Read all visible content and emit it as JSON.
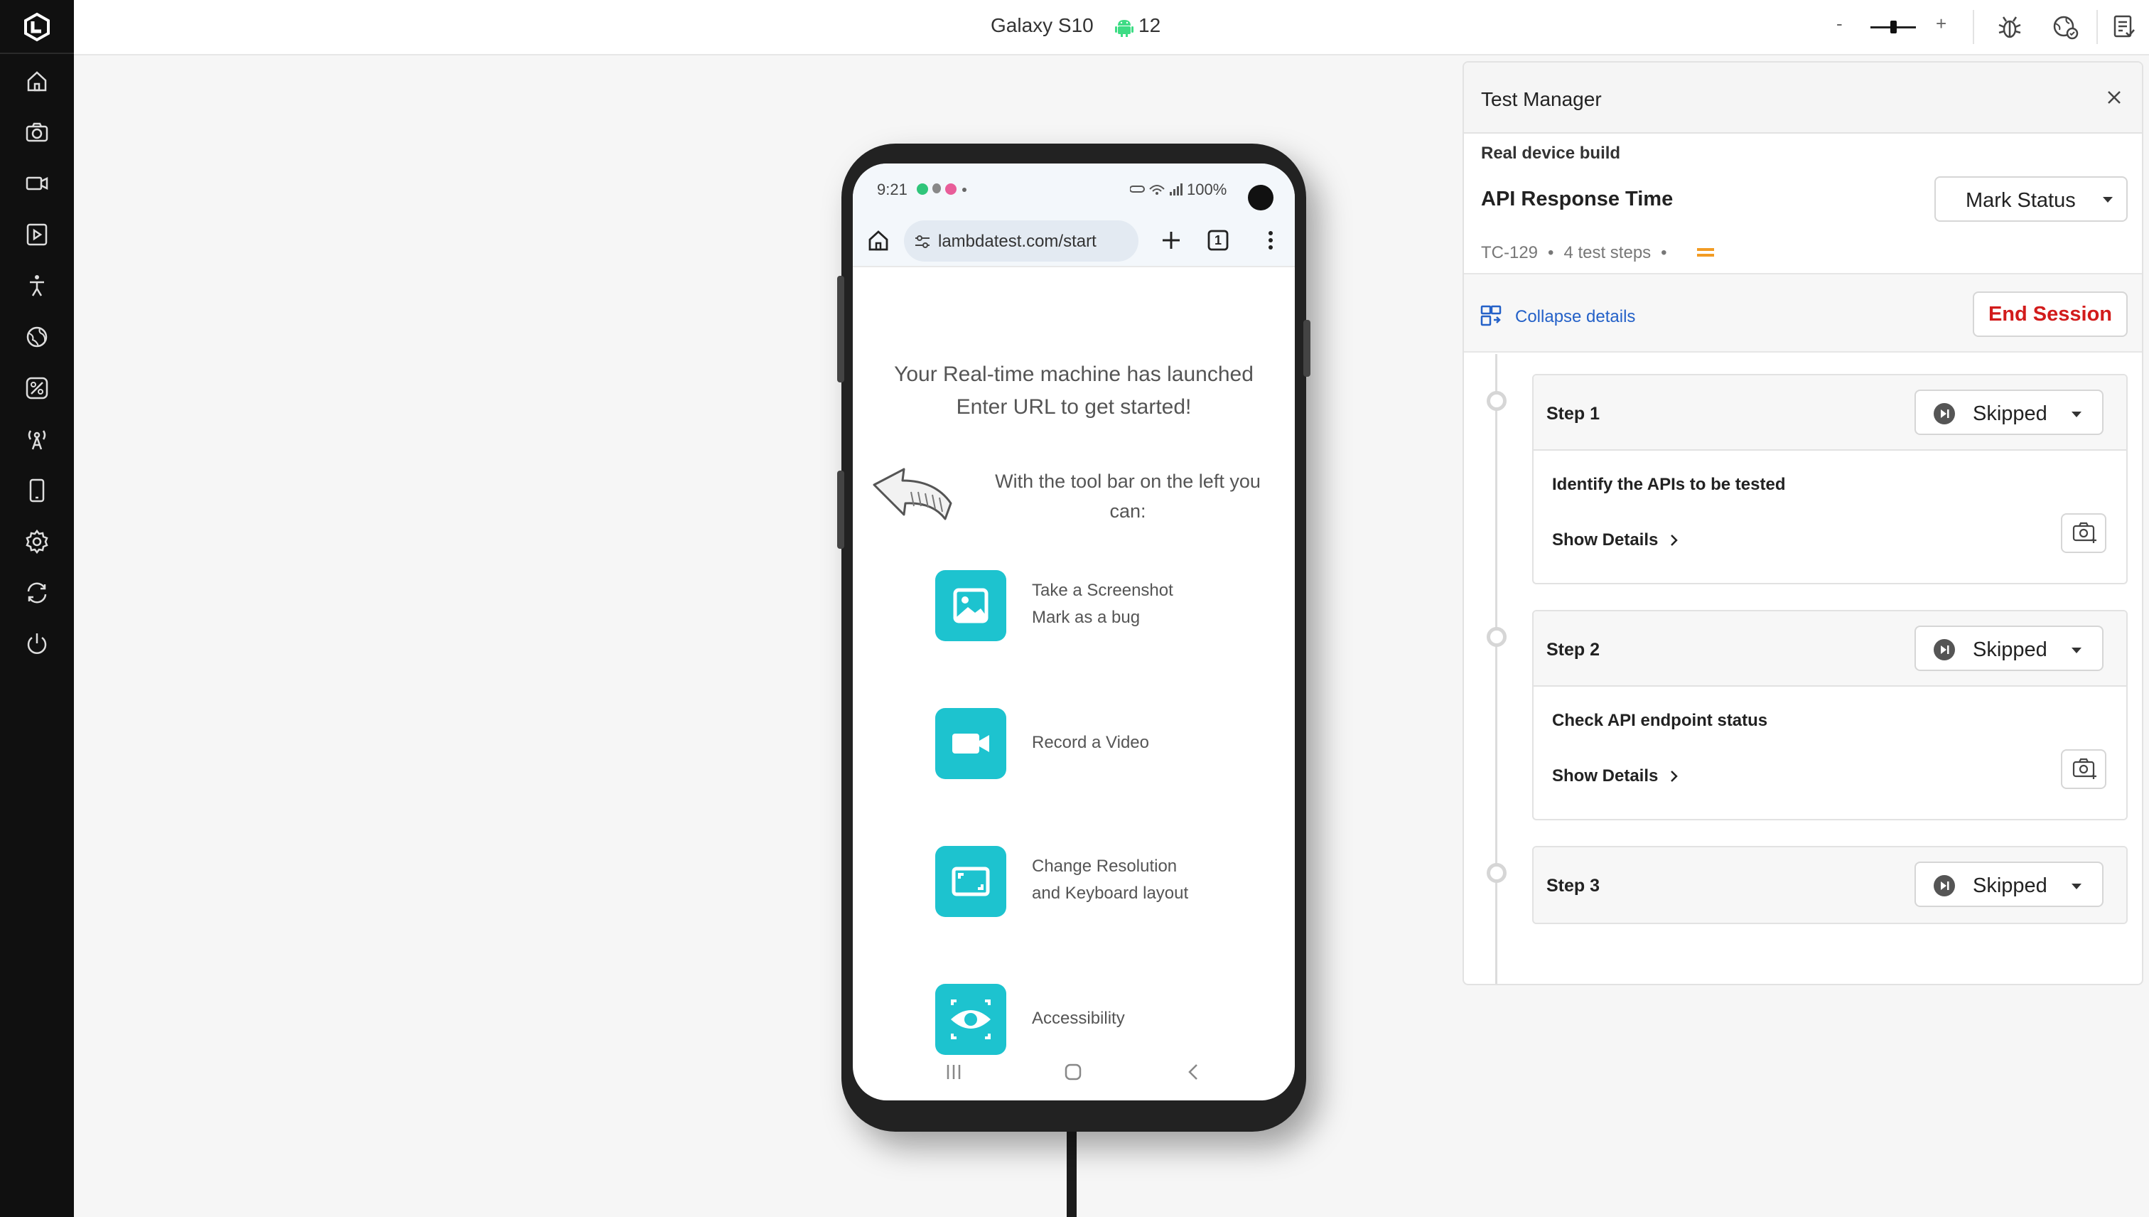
{
  "app": {
    "device_name": "Galaxy S10",
    "os_version": "12",
    "zoom": {
      "minus": "-",
      "plus": "+",
      "level": 0.5
    },
    "colors": {
      "sidebar": "#101010",
      "accent_teal": "#1dc3cf",
      "link_blue": "#2461c8",
      "danger_red": "#d21c1c",
      "android_green": "#3ddc84"
    }
  },
  "sidebar": {
    "items": [
      {
        "icon": "home-icon"
      },
      {
        "icon": "camera-icon"
      },
      {
        "icon": "video-icon"
      },
      {
        "icon": "media-icon"
      },
      {
        "icon": "accessibility-icon"
      },
      {
        "icon": "globe-icon"
      },
      {
        "icon": "location-icon"
      },
      {
        "icon": "network-tower-icon"
      },
      {
        "icon": "device-icon"
      },
      {
        "icon": "settings-icon"
      },
      {
        "icon": "switch-device-icon"
      },
      {
        "icon": "power-icon"
      }
    ]
  },
  "device_screen": {
    "status": {
      "time": "9:21",
      "battery": "100%"
    },
    "browser": {
      "url": "lambdatest.com/start",
      "tab_count": "1"
    },
    "launch_title_line1": "Your Real-time machine has launched",
    "launch_title_line2": "Enter URL to get started!",
    "toolbar_intro_line1": "With the tool bar on the left you",
    "toolbar_intro_line2": "can:",
    "features": [
      {
        "line1": "Take a Screenshot",
        "line2": "Mark as a bug",
        "icon": "image-icon"
      },
      {
        "line1": "Record a Video",
        "line2": "",
        "icon": "video-camera-icon"
      },
      {
        "line1": "Change Resolution",
        "line2": "and Keyboard layout",
        "icon": "resolution-icon"
      },
      {
        "line1": "Accessibility",
        "line2": "",
        "icon": "eye-icon"
      }
    ]
  },
  "test_manager": {
    "title": "Test Manager",
    "build": "Real device build",
    "test_name": "API Response Time",
    "mark_status": "Mark Status",
    "test_id": "TC-129",
    "step_count": "4 test steps",
    "collapse_label": "Collapse details",
    "end_session": "End Session",
    "steps": [
      {
        "title": "Step 1",
        "status": "Skipped",
        "description": "Identify the APIs to be tested",
        "show_details": "Show Details"
      },
      {
        "title": "Step 2",
        "status": "Skipped",
        "description": "Check API endpoint status",
        "show_details": "Show Details"
      },
      {
        "title": "Step 3",
        "status": "Skipped"
      }
    ]
  }
}
